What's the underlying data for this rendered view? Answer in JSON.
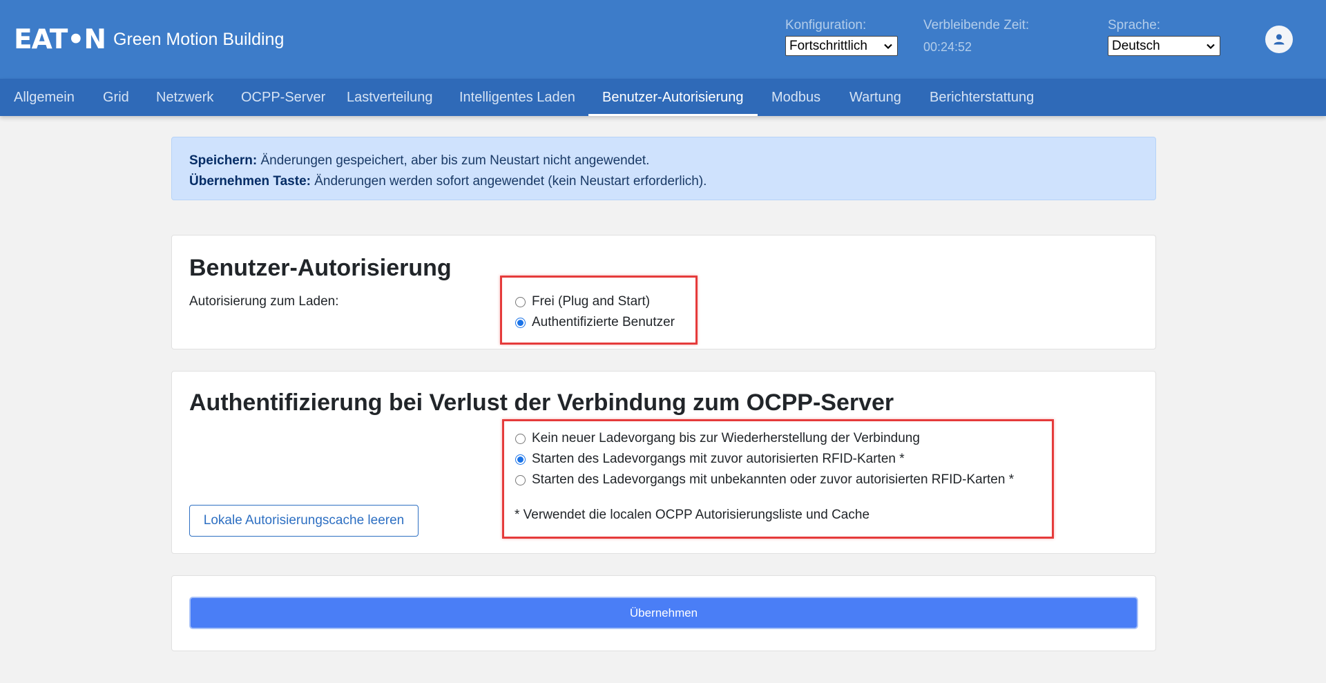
{
  "header": {
    "logo_text": "EAT•N",
    "app_title": "Green Motion Building",
    "config_label": "Konfiguration:",
    "config_value": "Fortschrittlich",
    "remaining_label": "Verbleibende Zeit:",
    "remaining_value": "00:24:52",
    "language_label": "Sprache:",
    "language_value": "Deutsch",
    "user_icon": "user-icon"
  },
  "nav": {
    "items": [
      {
        "label": "Allgemein"
      },
      {
        "label": "Grid"
      },
      {
        "label": "Netzwerk"
      },
      {
        "label": "OCPP-Server"
      },
      {
        "label": "Lastverteilung"
      },
      {
        "label": "Intelligentes Laden"
      },
      {
        "label": "Benutzer-Autorisierung"
      },
      {
        "label": "Modbus"
      },
      {
        "label": "Wartung"
      },
      {
        "label": "Berichterstattung"
      }
    ],
    "active": "Benutzer-Autorisierung"
  },
  "alert": {
    "save_bold": "Speichern:",
    "save_text": " Änderungen gespeichert, aber bis zum Neustart nicht angewendet.",
    "apply_bold": "Übernehmen Taste:",
    "apply_text": " Änderungen werden sofort angewendet (kein Neustart erforderlich)."
  },
  "user_auth": {
    "title": "Benutzer-Autorisierung",
    "field_label": "Autorisierung zum Laden:",
    "options": [
      {
        "label": "Frei (Plug and Start)",
        "checked": false
      },
      {
        "label": "Authentifizierte Benutzer",
        "checked": true
      }
    ]
  },
  "offline_auth": {
    "title": "Authentifizierung bei Verlust der Verbindung zum OCPP-Server",
    "options": [
      {
        "label": "Kein neuer Ladevorgang bis zur Wiederherstellung der Verbindung",
        "checked": false
      },
      {
        "label": "Starten des Ladevorgangs mit zuvor autorisierten RFID-Karten *",
        "checked": true
      },
      {
        "label": "Starten des Ladevorgangs mit unbekannten oder zuvor autorisierten RFID-Karten *",
        "checked": false
      }
    ],
    "note": "* Verwendet die localen OCPP Autorisierungsliste und Cache",
    "clear_cache_label": "Lokale Autorisierungscache leeren"
  },
  "footer": {
    "apply_label": "Übernehmen"
  },
  "colors": {
    "header_bg": "#3d7cc9",
    "nav_bg": "#2f6ab8",
    "alert_bg": "#cfe2fd",
    "primary": "#4a7ef6",
    "highlight": "#e53b3b"
  }
}
